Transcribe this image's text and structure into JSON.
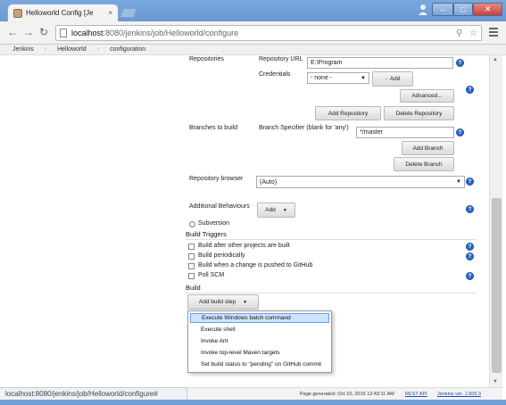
{
  "browser": {
    "tab_title": "Helloworld Config [Je",
    "tab_close": "×",
    "url_host": "localhost",
    "url_path": ":8080/jenkins/job/Helloworld/configure",
    "back_icon": "arrow-left",
    "forward_icon": "arrow-right",
    "reload_icon": "reload",
    "window_controls": {
      "minimize": "–",
      "maximize": "□",
      "close": "✕"
    }
  },
  "breadcrumb": [
    "Jenkins",
    "Helloworld",
    "configuration"
  ],
  "scm": {
    "repositories_label": "Repositories",
    "repo_url_label": "Repository URL",
    "repo_url_value": "E:\\Program",
    "credentials_label": "Credentials",
    "credentials_value": "- none -",
    "add_credentials_label": "Add",
    "advanced_label": "Advanced...",
    "add_repository_label": "Add Repository",
    "delete_repository_label": "Delete Repository",
    "branches_label": "Branches to build",
    "branch_specifier_label": "Branch Specifier (blank for 'any')",
    "branch_specifier_value": "*/master",
    "add_branch_label": "Add Branch",
    "delete_branch_label": "Delete Branch",
    "repo_browser_label": "Repository browser",
    "repo_browser_value": "(Auto)",
    "additional_behaviours_label": "Additional Behaviours",
    "add_behaviour_label": "Add",
    "subversion_label": "Subversion"
  },
  "build_triggers": {
    "title": "Build Triggers",
    "items": [
      "Build after other projects are built",
      "Build periodically",
      "Build when a change is pushed to GitHub",
      "Poll SCM"
    ]
  },
  "build": {
    "title": "Build",
    "add_build_step_label": "Add build step",
    "menu_items": [
      "Execute Windows batch command",
      "Execute shell",
      "Invoke Ant",
      "Invoke top-level Maven targets",
      "Set build status to \"pending\" on GitHub commit"
    ]
  },
  "status_bar": "localhost:8080/jenkins/job/Helloworld/configure#",
  "footer": {
    "generated": "Page generated: Oct 10, 2015 12:43:11 AM",
    "rest_api": "REST API",
    "version": "Jenkins ver. 1.609.3"
  },
  "help_glyph": "?",
  "colors": {
    "help_blue": "#2b68c8",
    "chrome_blue": "#6fa0d8",
    "highlight": "#cfe2ff",
    "link": "#1d4fb0"
  }
}
